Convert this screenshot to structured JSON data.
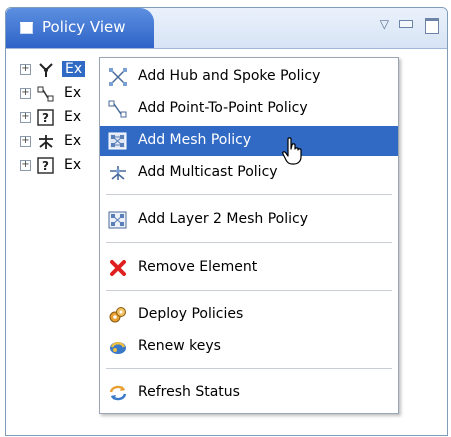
{
  "view": {
    "tab_title": "Policy View"
  },
  "tree": {
    "nodes": [
      {
        "label": "Ex",
        "selected": true,
        "icon": "hub-spoke-node-icon"
      },
      {
        "label": "Ex",
        "selected": false,
        "icon": "point-to-point-node-icon"
      },
      {
        "label": "Ex",
        "selected": false,
        "icon": "unknown-policy-node-icon"
      },
      {
        "label": "Ex",
        "selected": false,
        "icon": "multicast-node-icon"
      },
      {
        "label": "Ex",
        "selected": false,
        "icon": "unknown-policy-node-icon"
      }
    ]
  },
  "context_menu": {
    "items": [
      {
        "label": "Add Hub and Spoke Policy",
        "icon": "hub-spoke-icon"
      },
      {
        "label": "Add Point-To-Point Policy",
        "icon": "point-to-point-icon"
      },
      {
        "label": "Add Mesh Policy",
        "icon": "mesh-icon",
        "highlighted": true
      },
      {
        "label": "Add Multicast Policy",
        "icon": "multicast-icon"
      },
      {
        "label": "Add Layer 2 Mesh Policy",
        "icon": "layer2-mesh-icon"
      },
      {
        "label": "Remove Element",
        "icon": "remove-icon"
      },
      {
        "label": "Deploy Policies",
        "icon": "deploy-icon"
      },
      {
        "label": "Renew keys",
        "icon": "renew-keys-icon"
      },
      {
        "label": "Refresh Status",
        "icon": "refresh-icon"
      }
    ]
  },
  "colors": {
    "tab": "#3a70d0",
    "selection": "#316ac5",
    "remove": "#e02020"
  }
}
